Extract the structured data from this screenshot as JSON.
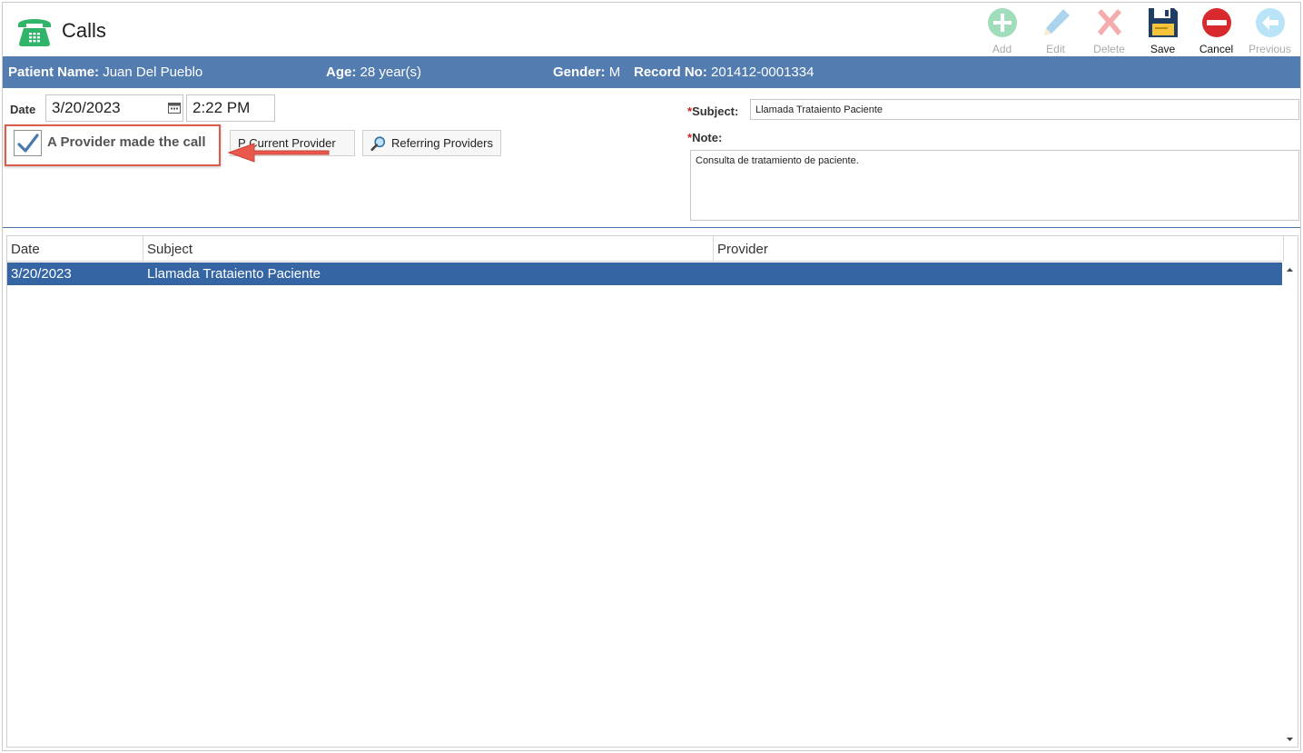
{
  "header": {
    "title": "Calls",
    "icon": "phone-icon",
    "toolbar": [
      {
        "id": "add",
        "label": "Add",
        "icon": "add-icon",
        "enabled": false,
        "color": "#2fb46a"
      },
      {
        "id": "edit",
        "label": "Edit",
        "icon": "pencil-icon",
        "enabled": false,
        "color": "#4a9fd8"
      },
      {
        "id": "delete",
        "label": "Delete",
        "icon": "delete-x-icon",
        "enabled": false,
        "color": "#f2a0a0"
      },
      {
        "id": "save",
        "label": "Save",
        "icon": "floppy-disk-icon",
        "enabled": true,
        "color": "#1e3e66"
      },
      {
        "id": "cancel",
        "label": "Cancel",
        "icon": "cancel-icon",
        "enabled": true,
        "color": "#d8292f"
      },
      {
        "id": "previous",
        "label": "Previous",
        "icon": "back-arrow-icon",
        "enabled": false,
        "color": "#66c3ec"
      }
    ]
  },
  "patient": {
    "name_label": "Patient Name:",
    "name": "Juan Del Pueblo",
    "age_label": "Age:",
    "age": "28 year(s)",
    "gender_label": "Gender:",
    "gender": "M",
    "record_label": "Record No:",
    "record": "201412-0001334",
    "bar_color": "#537cb0"
  },
  "form": {
    "date_label": "Date",
    "date_value": "3/20/2023",
    "time_value": "2:22 PM",
    "provider_checkbox_label": "A Provider made the call",
    "provider_checked": true,
    "current_provider_button": "Current Provider",
    "current_provider_prefix": "P",
    "referring_providers_button": "Referring Providers",
    "required_mark": "*",
    "subject_label": "Subject:",
    "subject_value": "Llamada Trataiento Paciente",
    "note_label": "Note:",
    "note_value": "Consulta de tratamiento de paciente."
  },
  "grid": {
    "columns": [
      "Date",
      "Subject",
      "Provider"
    ],
    "rows": [
      {
        "date": "3/20/2023",
        "subject": "Llamada Trataiento Paciente",
        "provider": "",
        "selected": true
      }
    ],
    "selected_color": "#3566a3"
  },
  "annotation": {
    "highlight_color": "#e05a4a"
  }
}
